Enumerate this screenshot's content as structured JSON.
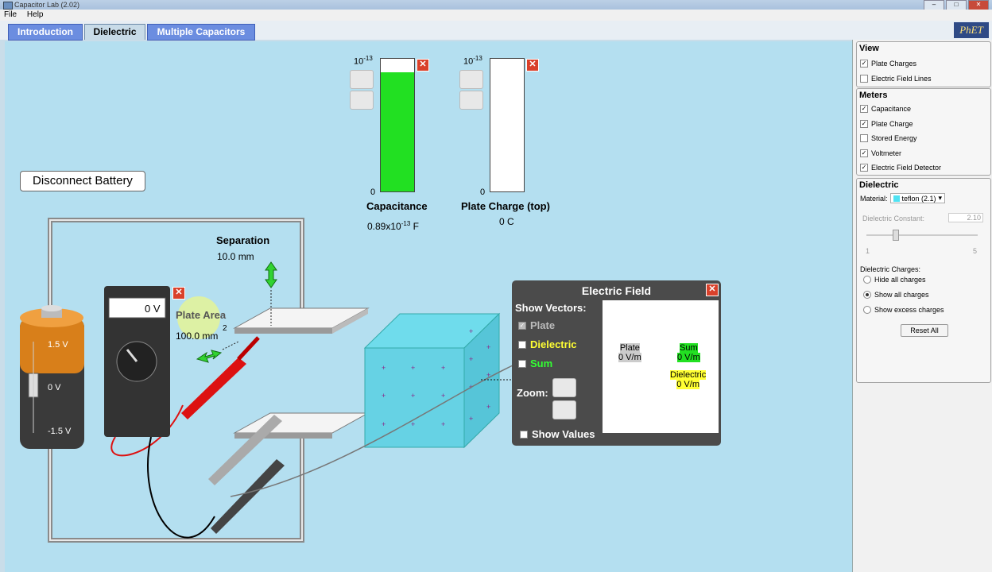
{
  "window": {
    "title": "Capacitor Lab (2.02)"
  },
  "menu": [
    "File",
    "Help"
  ],
  "tabs": [
    "Introduction",
    "Dielectric",
    "Multiple Capacitors"
  ],
  "logo": "PhET",
  "disconnect_label": "Disconnect Battery",
  "battery": {
    "top": "1.5 V",
    "mid": "0 V",
    "bot": "-1.5 V"
  },
  "voltmeter": {
    "reading": "0 V"
  },
  "separation": {
    "label": "Separation",
    "value": "10.0 mm"
  },
  "plate_area": {
    "label": "Plate Area",
    "value": "100.0 mm",
    "exp": "2"
  },
  "capacitance_meter": {
    "exp_top": "10",
    "exp_sup": "-13",
    "zero": "0",
    "label": "Capacitance",
    "value_prefix": "0.89x10",
    "value_sup": "-13",
    "value_unit": " F",
    "fill_fraction": 0.9
  },
  "charge_meter": {
    "exp_top": "10",
    "exp_sup": "-13",
    "zero": "0",
    "label": "Plate Charge (top)",
    "value": "0 C",
    "fill_fraction": 0.0
  },
  "electric_field": {
    "title": "Electric Field",
    "show_vectors": "Show Vectors:",
    "plate": "Plate",
    "dielectric": "Dielectric",
    "sum": "Sum",
    "zoom": "Zoom:",
    "show_values": "Show Values",
    "plate_val": "0 V/m",
    "sum_val": "0 V/m",
    "dielectric_val": "0 V/m"
  },
  "sidebar": {
    "view": {
      "title": "View",
      "items": [
        {
          "label": "Plate Charges",
          "checked": true
        },
        {
          "label": "Electric Field Lines",
          "checked": false
        }
      ]
    },
    "meters": {
      "title": "Meters",
      "items": [
        {
          "label": "Capacitance",
          "checked": true
        },
        {
          "label": "Plate Charge",
          "checked": true
        },
        {
          "label": "Stored Energy",
          "checked": false
        },
        {
          "label": "Voltmeter",
          "checked": true
        },
        {
          "label": "Electric Field Detector",
          "checked": true
        }
      ]
    },
    "dielectric": {
      "title": "Dielectric",
      "material_label": "Material:",
      "material_value": "teflon (2.1)",
      "constant_label": "Dielectric Constant:",
      "constant_value": "2.10",
      "slider_min": "1",
      "slider_max": "5",
      "charges_label": "Dielectric Charges:",
      "options": [
        "Hide all charges",
        "Show all charges",
        "Show excess charges"
      ],
      "selected": 1,
      "reset": "Reset All"
    }
  },
  "colors": {
    "accent_green": "#22e022",
    "tab_blue": "#6b8de0",
    "background": "#b4dff0"
  }
}
